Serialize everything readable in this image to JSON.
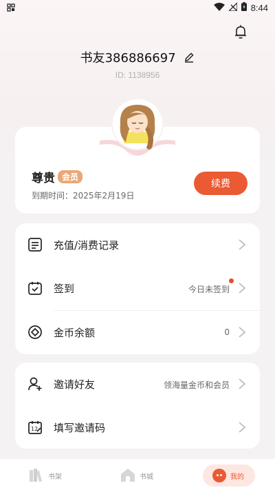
{
  "status": {
    "time": "8:44"
  },
  "profile": {
    "username": "书友386886697",
    "user_id": "ID: 1138956"
  },
  "vip": {
    "title": "尊贵",
    "badge": "会员",
    "expire": "到期时间：2025年2月19日",
    "renew_label": "续费"
  },
  "menu1": [
    {
      "label": "充值/消费记录",
      "value": "",
      "icon": "document-list-icon"
    },
    {
      "label": "签到",
      "value": "今日未签到",
      "icon": "calendar-check-icon"
    },
    {
      "label": "金币余额",
      "value": "0",
      "icon": "coin-icon"
    }
  ],
  "menu2": [
    {
      "label": "邀请好友",
      "value": "领海量金币和会员",
      "icon": "add-user-icon"
    },
    {
      "label": "填写邀请码",
      "value": "",
      "icon": "calendar-edit-icon"
    }
  ],
  "tabs": [
    {
      "label": "书架",
      "icon": "bookshelf-icon"
    },
    {
      "label": "书城",
      "icon": "home-icon"
    },
    {
      "label": "我的",
      "icon": "mine-icon"
    }
  ],
  "colors": {
    "accent": "#ea5a33",
    "vip_badge": "#e8a878",
    "page_bg": "#f4f2f3"
  }
}
